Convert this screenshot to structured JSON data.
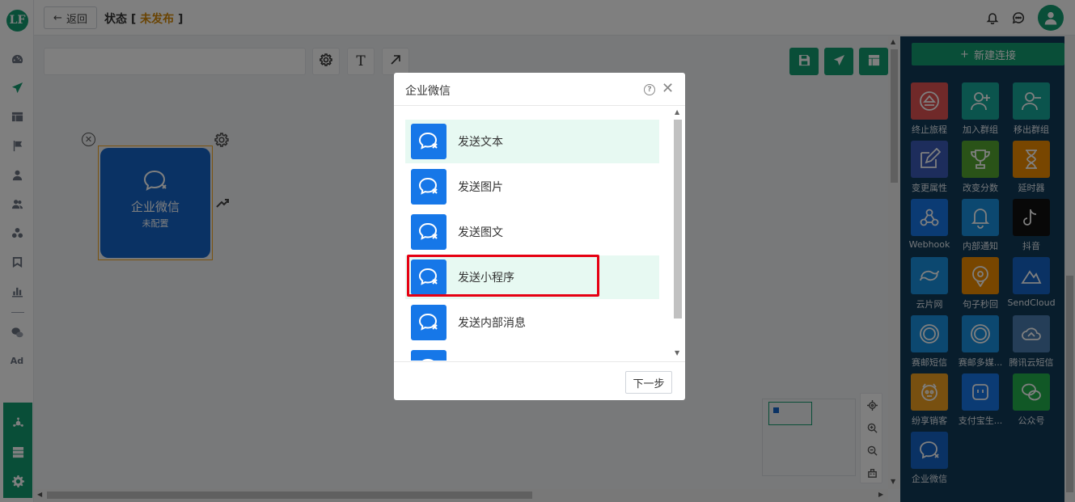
{
  "app": {
    "logo_text": "LF"
  },
  "topbar": {
    "back_label": "返回",
    "status_label": "状态 [ ",
    "status_value": "未发布",
    "status_close": " ]"
  },
  "node": {
    "title": "企业微信",
    "subtitle": "未配置"
  },
  "right_panel": {
    "new_connection_label": "新建连接",
    "tiles": [
      {
        "label": "终止旅程",
        "color": "#e05252",
        "icon": "eject-icon"
      },
      {
        "label": "加入群组",
        "color": "#16a99a",
        "icon": "user-add-icon"
      },
      {
        "label": "移出群组",
        "color": "#16a99a",
        "icon": "user-remove-icon"
      },
      {
        "label": "变更属性",
        "color": "#3b5bb8",
        "icon": "edit-icon"
      },
      {
        "label": "改变分数",
        "color": "#55a630",
        "icon": "trophy-icon"
      },
      {
        "label": "延时器",
        "color": "#f08c00",
        "icon": "hourglass-icon"
      },
      {
        "label": "Webhook",
        "color": "#1677e8",
        "icon": "webhook-icon"
      },
      {
        "label": "内部通知",
        "color": "#1890e0",
        "icon": "bell-icon"
      },
      {
        "label": "抖音",
        "color": "#111111",
        "icon": "tiktok-icon"
      },
      {
        "label": "云片网",
        "color": "#1890e0",
        "icon": "yunpian-icon"
      },
      {
        "label": "句子秒回",
        "color": "#f08c00",
        "icon": "chat-pin-icon"
      },
      {
        "label": "SendCloud",
        "color": "#1464c8",
        "icon": "sendcloud-icon"
      },
      {
        "label": "赛邮短信",
        "color": "#1890e0",
        "icon": "submail-icon"
      },
      {
        "label": "赛邮多媒...",
        "color": "#1890e0",
        "icon": "submail-media-icon"
      },
      {
        "label": "腾讯云短信",
        "color": "#4a7db0",
        "icon": "cloud-icon"
      },
      {
        "label": "纷享销客",
        "color": "#f0a020",
        "icon": "fxiaoke-icon"
      },
      {
        "label": "支付宝生...",
        "color": "#1677e8",
        "icon": "alipay-icon"
      },
      {
        "label": "公众号",
        "color": "#22b14c",
        "icon": "wechat-icon"
      },
      {
        "label": "企业微信",
        "color": "#1464c8",
        "icon": "wecom-icon"
      }
    ]
  },
  "modal": {
    "title": "企业微信",
    "items": [
      {
        "label": "发送文本"
      },
      {
        "label": "发送图片"
      },
      {
        "label": "发送图文"
      },
      {
        "label": "发送小程序"
      },
      {
        "label": "发送内部消息"
      },
      {
        "label": ""
      }
    ],
    "next_label": "下一步"
  },
  "colors": {
    "brand_green": "#129c71",
    "node_blue": "#1464c8",
    "panel_bg": "#103a59",
    "status_orange": "#d48806",
    "highlight_red": "#e60012"
  }
}
